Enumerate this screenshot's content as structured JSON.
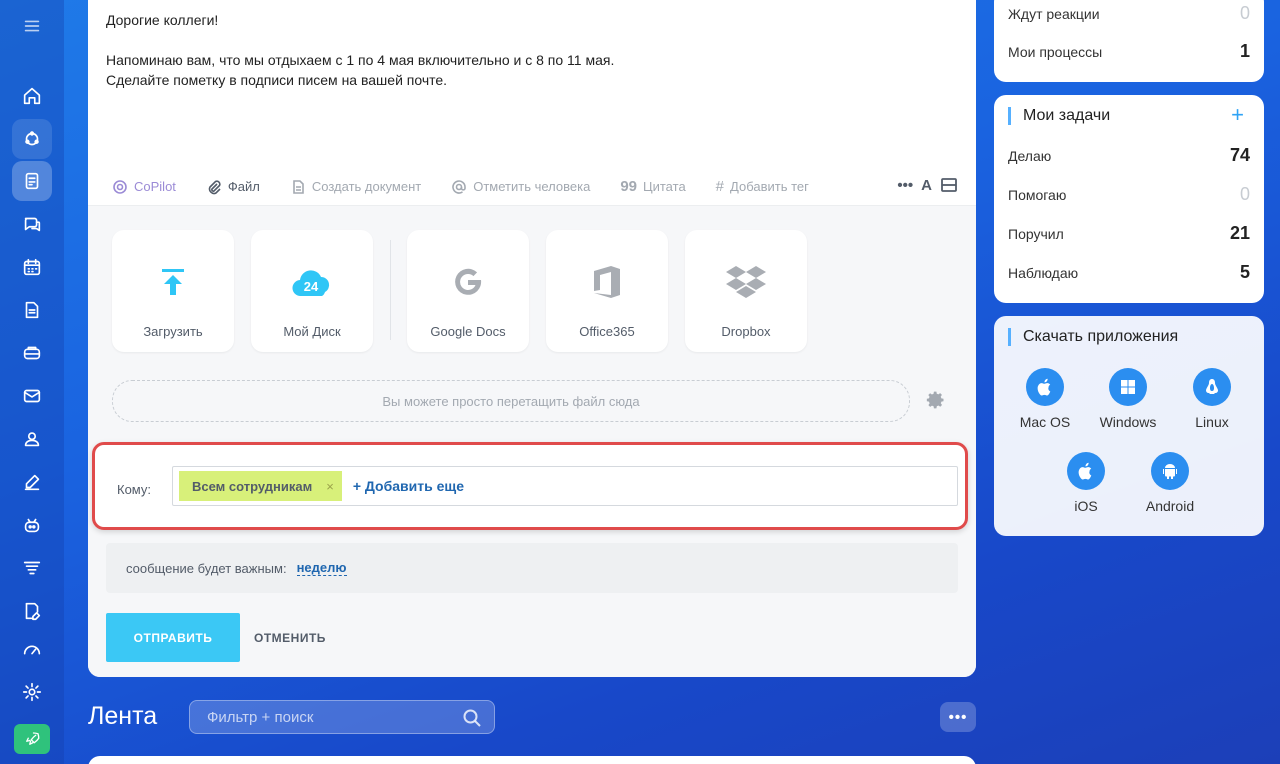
{
  "message": {
    "line1": "Дорогие коллеги!",
    "line2": "Напоминаю вам, что мы отдыхаем с 1 по 4 мая включительно и с 8 по 11 мая.",
    "line3": "Сделайте пометку в подписи писем на вашей почте."
  },
  "toolbar": {
    "copilot": "CoPilot",
    "file": "Файл",
    "create_doc": "Создать документ",
    "mention": "Отметить человека",
    "quote": "Цитата",
    "tag": "Добавить тег",
    "more": "•••",
    "font": "A"
  },
  "upload": {
    "tiles": [
      {
        "label": "Загрузить",
        "icon": "upload-icon"
      },
      {
        "label": "Мой Диск",
        "icon": "cloud-24-icon",
        "badge": "24"
      },
      {
        "label": "Google Docs",
        "icon": "google-icon"
      },
      {
        "label": "Office365",
        "icon": "office-icon"
      },
      {
        "label": "Dropbox",
        "icon": "dropbox-icon"
      }
    ],
    "dropzone": "Вы можете просто перетащить файл сюда"
  },
  "recipients": {
    "label": "Кому:",
    "chip": "Всем сотрудникам",
    "chip_remove": "×",
    "add_more": "+ Добавить еще"
  },
  "important": {
    "text": "сообщение будет важным:",
    "period": "неделю"
  },
  "actions": {
    "send": "ОТПРАВИТЬ",
    "cancel": "ОТМЕНИТЬ"
  },
  "feed": {
    "title": "Лента",
    "search_placeholder": "Фильтр + поиск",
    "more": "•••"
  },
  "processes": {
    "rows": [
      {
        "label": "Ждут реакции",
        "value": "0"
      },
      {
        "label": "Мои процессы",
        "value": "1"
      }
    ]
  },
  "tasks": {
    "title": "Мои задачи",
    "add": "+",
    "rows": [
      {
        "label": "Делаю",
        "value": "74"
      },
      {
        "label": "Помогаю",
        "value": "0"
      },
      {
        "label": "Поручил",
        "value": "21"
      },
      {
        "label": "Наблюдаю",
        "value": "5"
      }
    ]
  },
  "apps": {
    "title": "Скачать приложения",
    "items": [
      {
        "name": "Mac OS",
        "icon": "apple-icon"
      },
      {
        "name": "Windows",
        "icon": "windows-icon"
      },
      {
        "name": "Linux",
        "icon": "linux-icon"
      },
      {
        "name": "iOS",
        "icon": "apple-icon"
      },
      {
        "name": "Android",
        "icon": "android-icon"
      }
    ]
  },
  "colors": {
    "accent": "#3bc8f5",
    "link": "#2067b0",
    "chip": "#d8f07a",
    "highlight_border": "#e04b4b"
  }
}
